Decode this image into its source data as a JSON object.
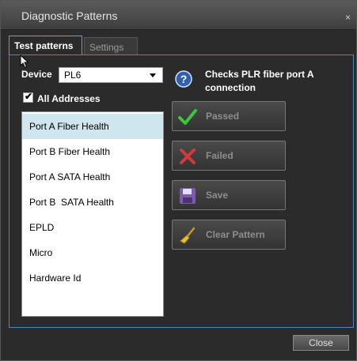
{
  "window": {
    "title": "Diagnostic Patterns",
    "close_glyph": "×"
  },
  "tabs": [
    {
      "label": "Test patterns",
      "active": true
    },
    {
      "label": "Settings",
      "active": false
    }
  ],
  "device": {
    "label": "Device",
    "value": "PL6"
  },
  "all_addresses": {
    "label": "All Addresses",
    "checked": true,
    "tick": "✔"
  },
  "patterns": [
    "Port A Fiber Health",
    "Port B Fiber Health",
    "Port A SATA Health",
    "Port B  SATA Health",
    "EPLD",
    "Micro",
    "Hardware Id"
  ],
  "selected_pattern_index": 0,
  "description": "Checks PLR fiber port A connection",
  "actions": {
    "passed": "Passed",
    "failed": "Failed",
    "save": "Save",
    "clear": "Clear Pattern"
  },
  "footer": {
    "close_label": "Close"
  },
  "colors": {
    "accent_border": "#4d88b8",
    "selected_row": "#cfe6ef",
    "passed_icon": "#3cc63c",
    "failed_icon": "#d43a3a",
    "save_icon": "#7a5ca8"
  },
  "icons": {
    "help": "question-circle-icon",
    "passed": "checkmark-icon",
    "failed": "x-mark-icon",
    "save": "floppy-disk-icon",
    "clear": "broom-icon"
  }
}
